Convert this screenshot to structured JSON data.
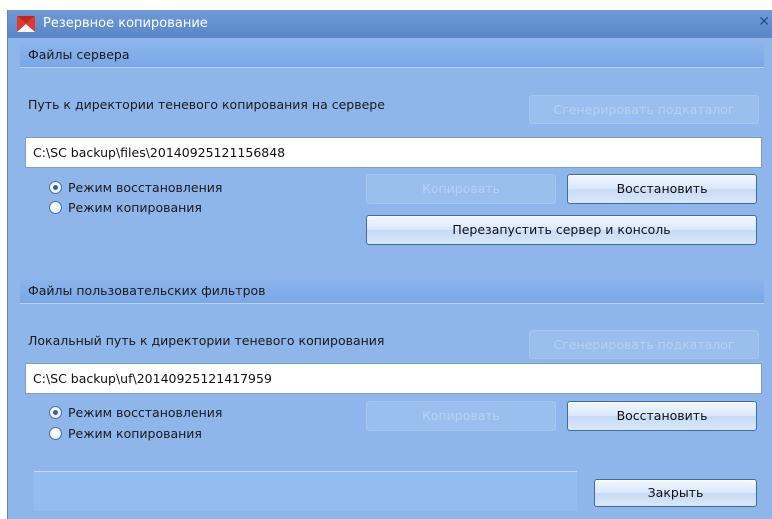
{
  "window": {
    "title": "Резервное копирование",
    "close_glyph": "✕"
  },
  "server": {
    "section_title": "Файлы сервера",
    "path_label": "Путь к директории теневого копирования на сервере",
    "generate_label": "Сгенерировать подкаталог",
    "path_value": "C:\\SC backup\\files\\20140925121156848",
    "mode_restore_label": "Режим восстановления",
    "mode_copy_label": "Режим копирования",
    "selected_mode": "restore",
    "copy_label": "Копировать",
    "restore_label": "Восстановить",
    "restart_label": "Перезапустить сервер и консоль"
  },
  "filters": {
    "section_title": "Файлы пользовательских фильтров",
    "path_label": "Локальный путь к директории теневого копирования",
    "generate_label": "Сгенерировать подкаталог",
    "path_value": "C:\\SC backup\\uf\\20140925121417959",
    "mode_restore_label": "Режим восстановления",
    "mode_copy_label": "Режим копирования",
    "selected_mode": "restore",
    "copy_label": "Копировать",
    "restore_label": "Восстановить"
  },
  "footer": {
    "close_label": "Закрыть"
  },
  "colors": {
    "panel": "#8fb6ea",
    "titlebar": "#5a86c8",
    "button_border": "#3f6aa6"
  }
}
